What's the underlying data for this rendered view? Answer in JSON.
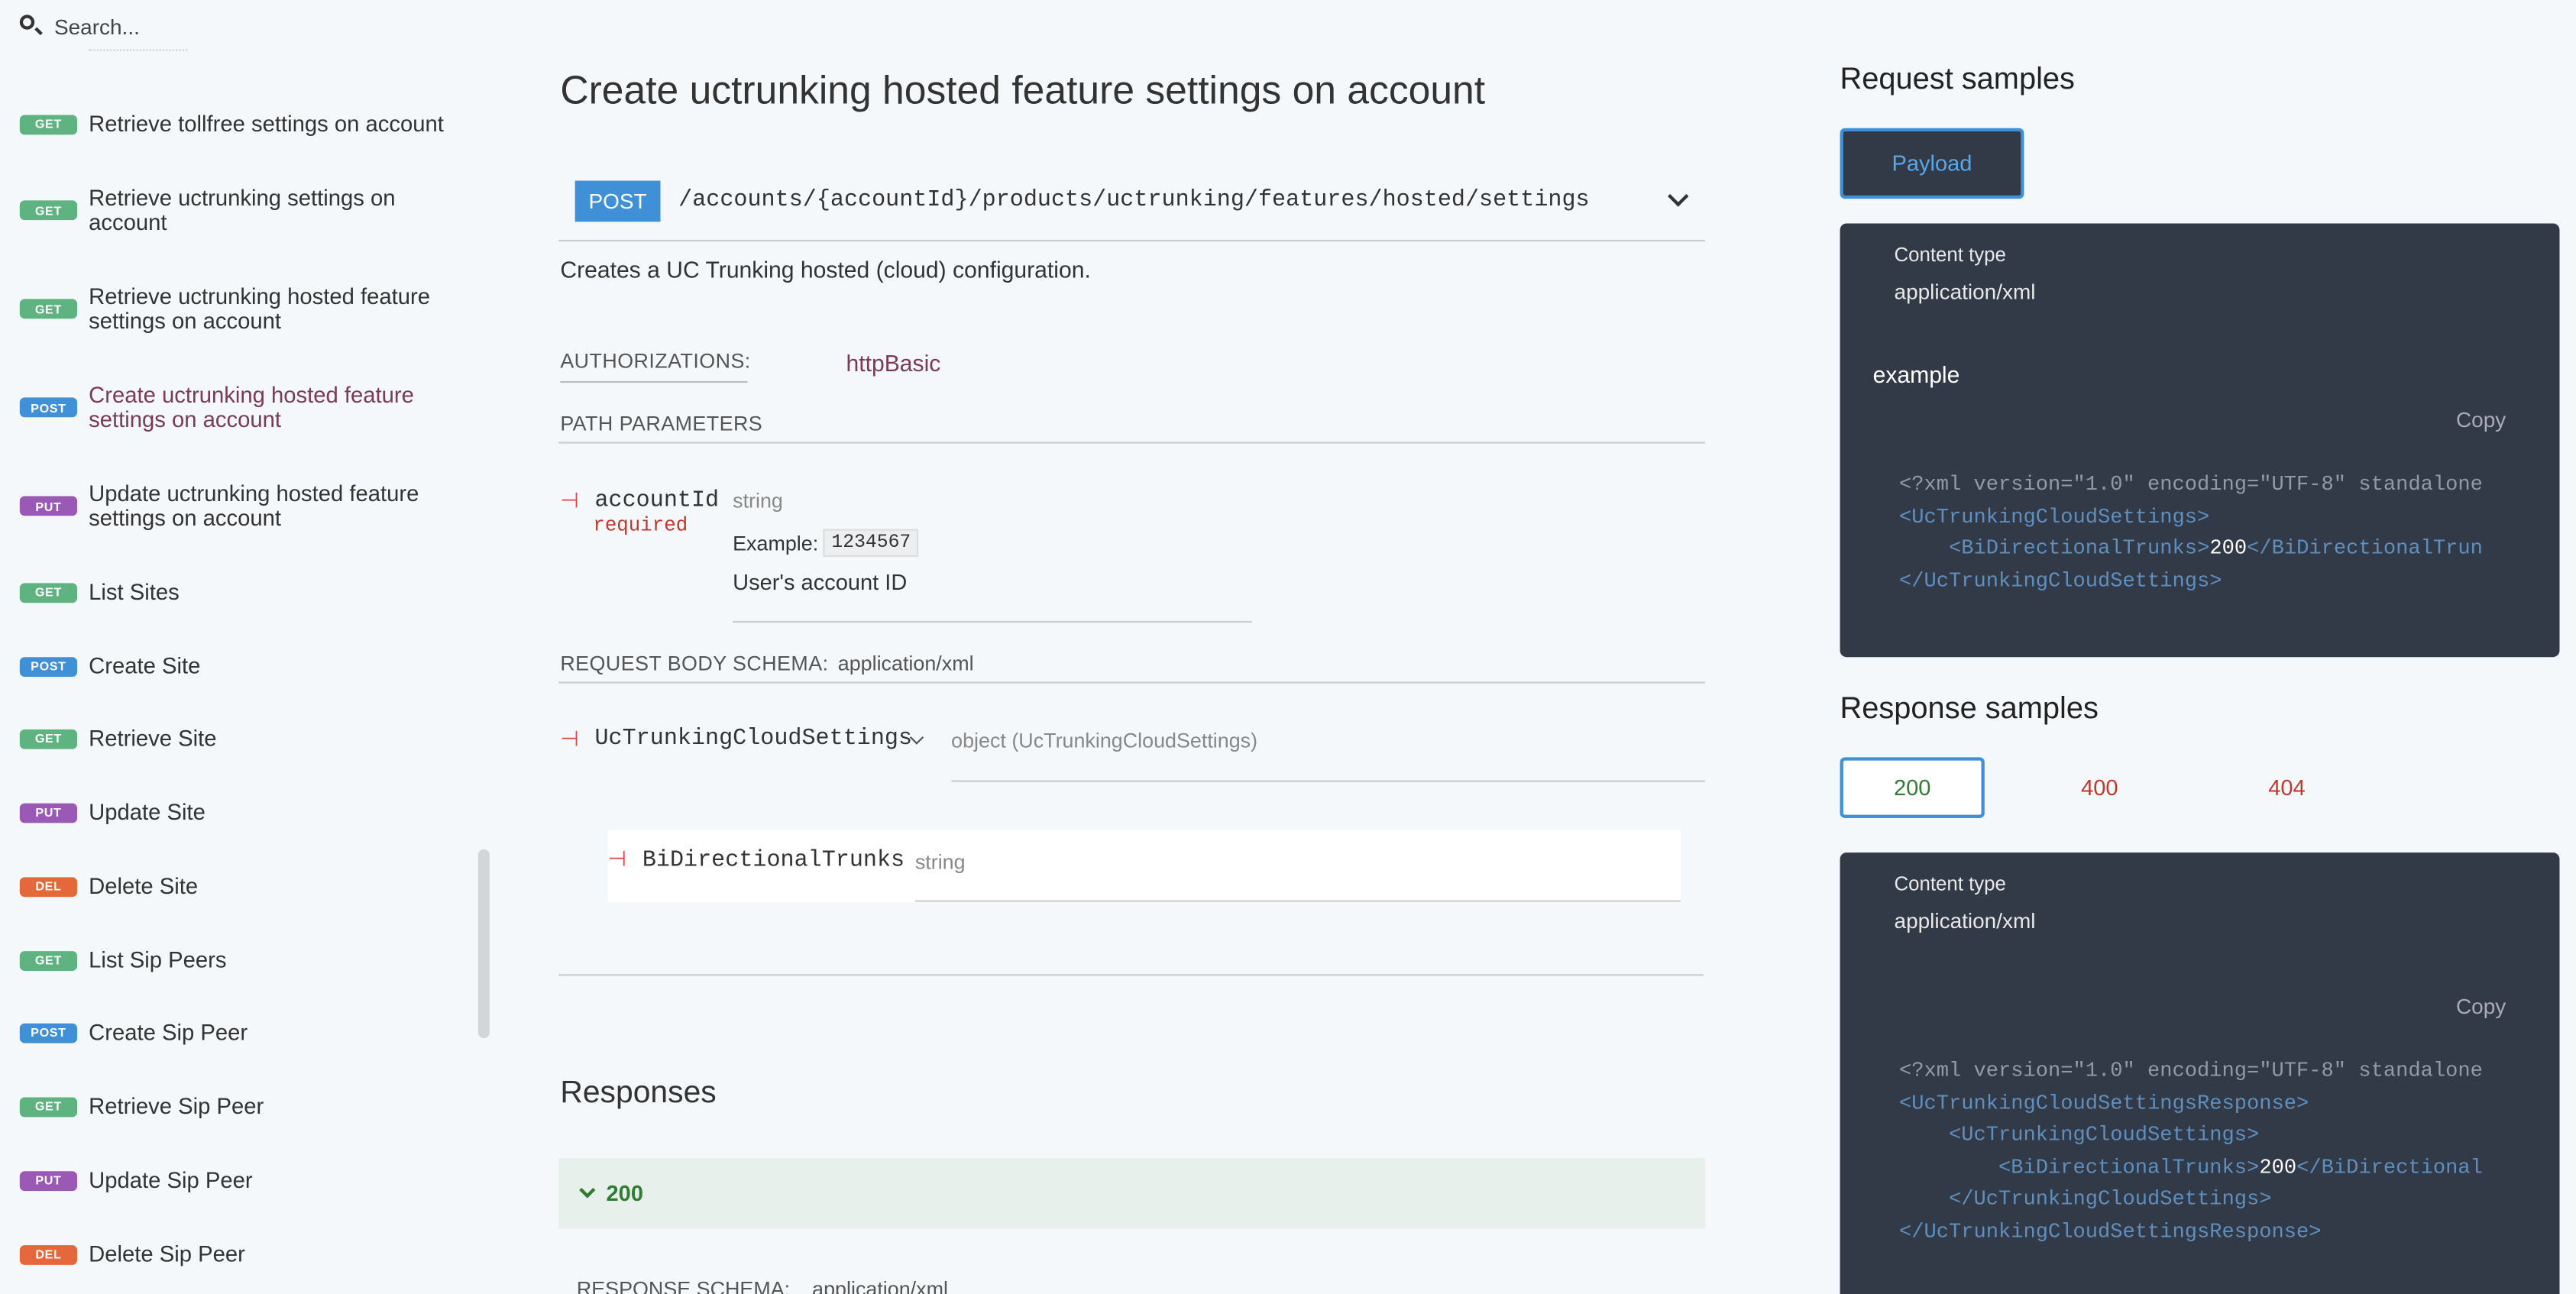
{
  "sidebar": {
    "search_placeholder": "Search...",
    "items": [
      {
        "method": "GET",
        "label": "Retrieve tollfree settings on account"
      },
      {
        "method": "GET",
        "label": "Retrieve uctrunking settings on account"
      },
      {
        "method": "GET",
        "label": "Retrieve uctrunking hosted feature settings on account"
      },
      {
        "method": "POST",
        "label": "Create uctrunking hosted feature settings on account",
        "active": true
      },
      {
        "method": "PUT",
        "label": "Update uctrunking hosted feature settings on account"
      },
      {
        "method": "GET",
        "label": "List Sites"
      },
      {
        "method": "POST",
        "label": "Create Site"
      },
      {
        "method": "GET",
        "label": "Retrieve Site"
      },
      {
        "method": "PUT",
        "label": "Update Site"
      },
      {
        "method": "DEL",
        "label": "Delete Site"
      },
      {
        "method": "GET",
        "label": "List Sip Peers"
      },
      {
        "method": "POST",
        "label": "Create Sip Peer"
      },
      {
        "method": "GET",
        "label": "Retrieve Sip Peer"
      },
      {
        "method": "PUT",
        "label": "Update Sip Peer"
      },
      {
        "method": "DEL",
        "label": "Delete Sip Peer"
      }
    ]
  },
  "main": {
    "title": "Create uctrunking hosted feature settings on account",
    "method": "POST",
    "path": "/accounts/{accountId}/products/uctrunking/features/hosted/settings",
    "description": "Creates a UC Trunking hosted (cloud) configuration.",
    "authorizations_label": "AUTHORIZATIONS:",
    "authorizations_value": "httpBasic",
    "path_params_label": "PATH PARAMETERS",
    "param": {
      "name": "accountId",
      "required": "required",
      "type": "string",
      "example_label": "Example:",
      "example_value": "1234567",
      "description": "User's account ID"
    },
    "request_body_label": "REQUEST BODY SCHEMA:",
    "request_body_type": "application/xml",
    "body_object": {
      "name": "UcTrunkingCloudSettings",
      "type": "object (UcTrunkingCloudSettings)"
    },
    "body_field": {
      "name": "BiDirectionalTrunks",
      "type": "string"
    },
    "responses_title": "Responses",
    "response_200": "200",
    "response_schema_label": "RESPONSE SCHEMA:",
    "response_schema_type": "application/xml"
  },
  "right": {
    "request_samples_title": "Request samples",
    "payload_tab": "Payload",
    "request": {
      "content_type_label": "Content type",
      "content_type_value": "application/xml",
      "example_label": "example",
      "copy_label": "Copy",
      "xml_decl": "<?xml version=\"1.0\" encoding=\"UTF-8\" standalone",
      "open_root": "<UcTrunkingCloudSettings>",
      "field_open": "<BiDirectionalTrunks>",
      "field_value": "200",
      "field_close": "</BiDirectionalTrun",
      "close_root": "</UcTrunkingCloudSettings>"
    },
    "response_samples_title": "Response samples",
    "response_tabs": [
      "200",
      "400",
      "404"
    ],
    "response": {
      "content_type_label": "Content type",
      "content_type_value": "application/xml",
      "copy_label": "Copy",
      "xml_decl": "<?xml version=\"1.0\" encoding=\"UTF-8\" standalone",
      "open_root": "<UcTrunkingCloudSettingsResponse>",
      "open_inner": "<UcTrunkingCloudSettings>",
      "field_open": "<BiDirectionalTrunks>",
      "field_value": "200",
      "field_close": "</BiDirectional",
      "close_inner": "</UcTrunkingCloudSettings>",
      "close_root": "</UcTrunkingCloudSettingsResponse>"
    }
  },
  "colors": {
    "get": "#5fb381",
    "post": "#3f90d6",
    "put": "#9b59b6",
    "del": "#e5683d",
    "code_bg": "#323a47",
    "active_link": "#7a3a5a"
  }
}
